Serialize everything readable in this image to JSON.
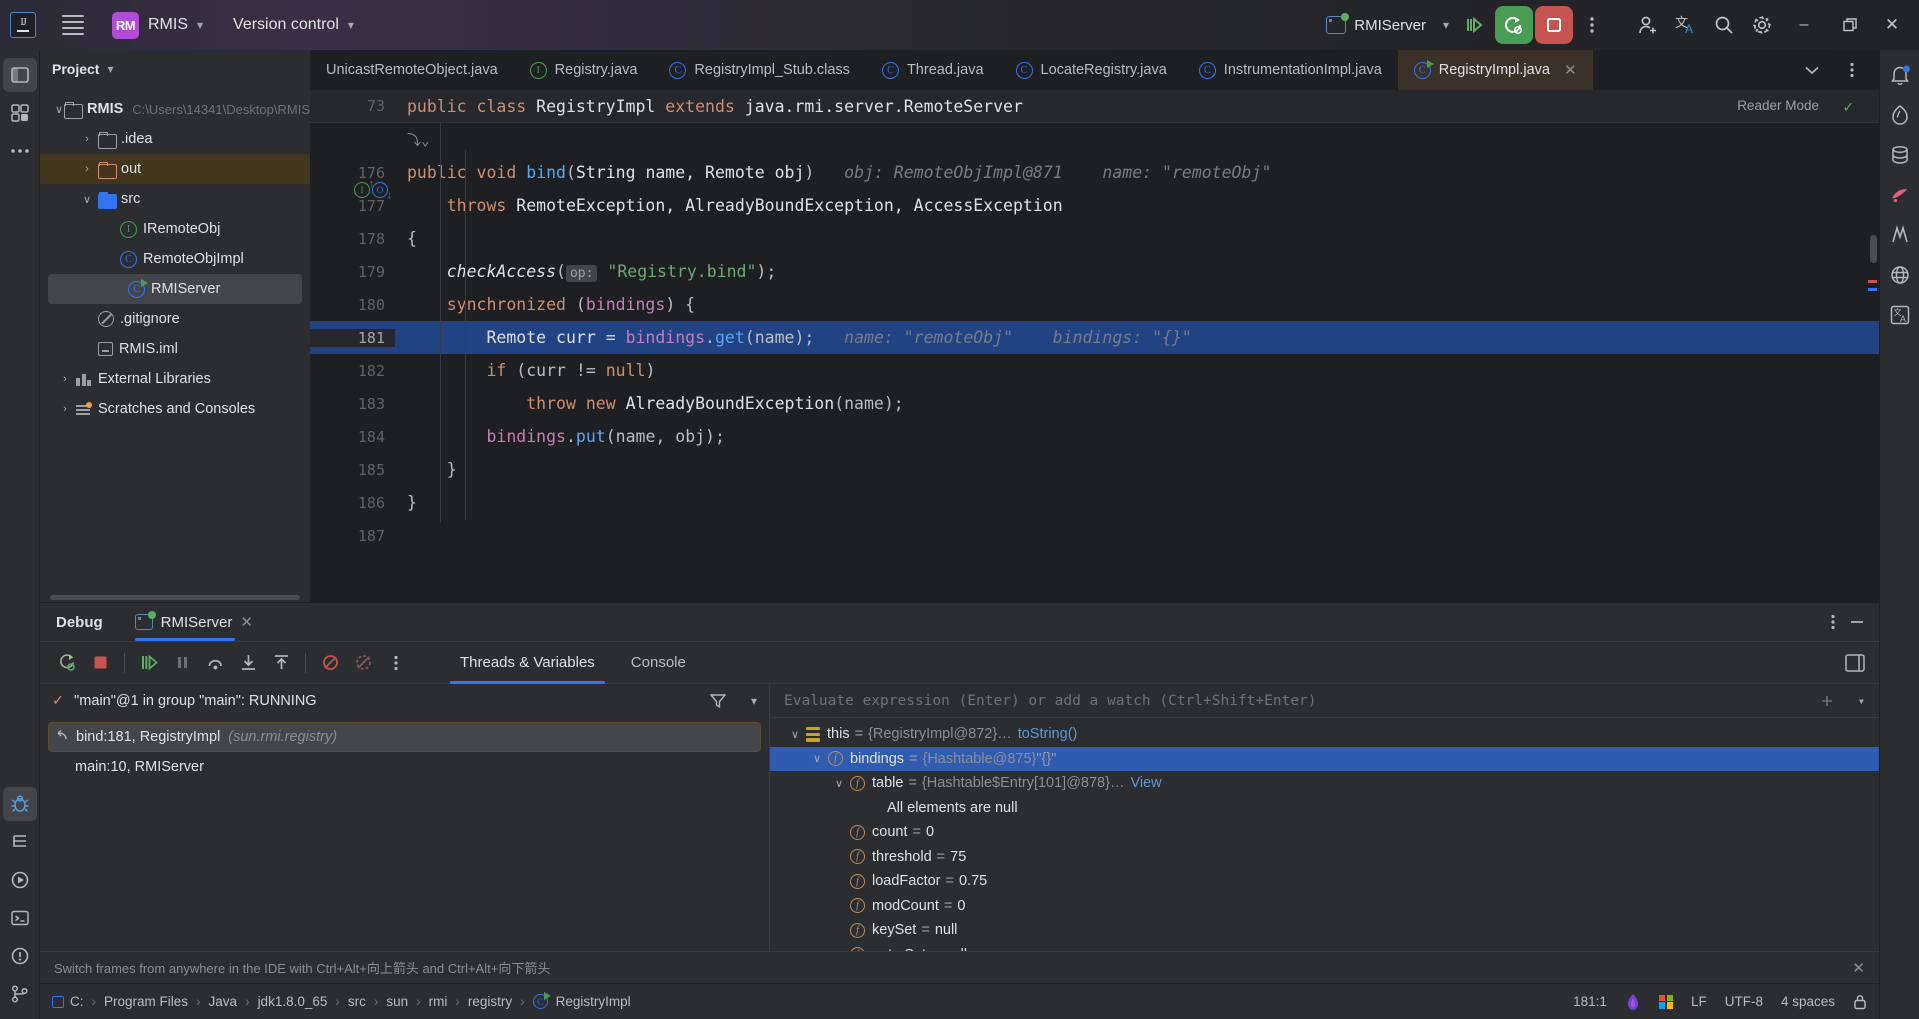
{
  "titlebar": {
    "menu_icon": "hamburger-icon",
    "project_badge": "RM",
    "project_name": "RMIS",
    "version_control": "Version control",
    "run_config": "RMIServer",
    "icons": [
      "debug-icon",
      "run-with-coverage-icon",
      "stop-icon",
      "more-actions-icon",
      "add-user-icon",
      "translate-icon",
      "search-icon",
      "settings-icon"
    ],
    "window": {
      "minimize": "–",
      "maximize": "❐",
      "close": "✕"
    }
  },
  "project_panel": {
    "title": "Project",
    "tree": [
      {
        "label": "RMIS",
        "path": "C:\\Users\\14341\\Desktop\\RMIS",
        "icon": "project-folder-icon",
        "arrow": "∨",
        "indent": 0,
        "bold": true,
        "state": "none"
      },
      {
        "label": ".idea",
        "path": "",
        "icon": "folder-icon",
        "arrow": "›",
        "indent": 1,
        "bold": false,
        "state": "none"
      },
      {
        "label": "out",
        "path": "",
        "icon": "folder-orange-icon",
        "arrow": "›",
        "indent": 1,
        "bold": false,
        "state": "highlight"
      },
      {
        "label": "src",
        "path": "",
        "icon": "folder-blue-icon",
        "arrow": "∨",
        "indent": 1,
        "bold": false,
        "state": "none"
      },
      {
        "label": "IRemoteObj",
        "path": "",
        "icon": "interface-icon",
        "arrow": "",
        "indent": 2,
        "bold": false,
        "state": "none"
      },
      {
        "label": "RemoteObjImpl",
        "path": "",
        "icon": "class-icon",
        "arrow": "",
        "indent": 2,
        "bold": false,
        "state": "none"
      },
      {
        "label": "RMIServer",
        "path": "",
        "icon": "runnable-class-icon",
        "arrow": "",
        "indent": 2,
        "bold": false,
        "state": "selected"
      },
      {
        "label": ".gitignore",
        "path": "",
        "icon": "gitignore-icon",
        "arrow": "",
        "indent": 1,
        "bold": false,
        "state": "none"
      },
      {
        "label": "RMIS.iml",
        "path": "",
        "icon": "iml-icon",
        "arrow": "",
        "indent": 1,
        "bold": false,
        "state": "none"
      },
      {
        "label": "External Libraries",
        "path": "",
        "icon": "library-icon",
        "arrow": "›",
        "indent": 0,
        "bold": false,
        "state": "none"
      },
      {
        "label": "Scratches and Consoles",
        "path": "",
        "icon": "scratches-icon",
        "arrow": "›",
        "indent": 0,
        "bold": false,
        "state": "none"
      }
    ]
  },
  "editor": {
    "tabs": [
      {
        "label": "UnicastRemoteObject.java",
        "icon": "",
        "active": false,
        "closable": false
      },
      {
        "label": "Registry.java",
        "icon": "interface-icon",
        "active": false,
        "closable": false
      },
      {
        "label": "RegistryImpl_Stub.class",
        "icon": "class-decompiled-icon",
        "active": false,
        "closable": false
      },
      {
        "label": "Thread.java",
        "icon": "class-icon",
        "active": false,
        "closable": false
      },
      {
        "label": "LocateRegistry.java",
        "icon": "class-decompiled-icon",
        "active": false,
        "closable": false
      },
      {
        "label": "InstrumentationImpl.java",
        "icon": "class-icon",
        "active": false,
        "closable": false
      },
      {
        "label": "RegistryImpl.java",
        "icon": "runnable-class-icon",
        "active": true,
        "closable": true
      }
    ],
    "tab_actions": [
      "chevron-down-icon",
      "more-vertical-icon"
    ],
    "reader_mode": "Reader Mode",
    "inspection_status": "✓",
    "sticky_line": {
      "number": "73",
      "code": "public class RegistryImpl extends java.rmi.server.RemoteServer"
    },
    "lines": [
      {
        "number": "",
        "tokens": [
          {
            "t": "fold",
            "v": "⤵⌄"
          }
        ]
      },
      {
        "number": "176",
        "gutter_icons": [
          "implemented-method-icon",
          "overridden-method-icon"
        ],
        "tokens": [
          {
            "t": "kw",
            "v": "public "
          },
          {
            "t": "kw",
            "v": "void "
          },
          {
            "t": "meth",
            "v": "bind"
          },
          {
            "t": "plain",
            "v": "("
          },
          {
            "t": "typ",
            "v": "String name, Remote obj"
          },
          {
            "t": "plain",
            "v": ")"
          },
          {
            "t": "hint",
            "v": "   obj: RemoteObjImpl@871    name: \"remoteObj\""
          }
        ]
      },
      {
        "number": "177",
        "tokens": [
          {
            "t": "plain",
            "v": "    "
          },
          {
            "t": "kw",
            "v": "throws "
          },
          {
            "t": "typ",
            "v": "RemoteException, AlreadyBoundException, AccessException"
          }
        ]
      },
      {
        "number": "178",
        "tokens": [
          {
            "t": "plain",
            "v": "{"
          }
        ]
      },
      {
        "number": "179",
        "tokens": [
          {
            "t": "plain",
            "v": "    "
          },
          {
            "t": "ital",
            "v": "checkAccess"
          },
          {
            "t": "plain",
            "v": "("
          },
          {
            "t": "badge",
            "v": "op:"
          },
          {
            "t": "str",
            "v": " \"Registry.bind\""
          },
          {
            "t": "plain",
            "v": ");"
          }
        ]
      },
      {
        "number": "180",
        "tokens": [
          {
            "t": "plain",
            "v": "    "
          },
          {
            "t": "kw",
            "v": "synchronized "
          },
          {
            "t": "plain",
            "v": "("
          },
          {
            "t": "fld",
            "v": "bindings"
          },
          {
            "t": "plain",
            "v": ") {"
          }
        ]
      },
      {
        "number": "181",
        "highlight": true,
        "tokens": [
          {
            "t": "plain",
            "v": "        "
          },
          {
            "t": "typ",
            "v": "Remote curr = "
          },
          {
            "t": "fld",
            "v": "bindings"
          },
          {
            "t": "plain",
            "v": "."
          },
          {
            "t": "meth",
            "v": "get"
          },
          {
            "t": "plain",
            "v": "(name);"
          },
          {
            "t": "hint",
            "v": "   name: \"remoteObj\"    bindings: \"{}\""
          }
        ]
      },
      {
        "number": "182",
        "tokens": [
          {
            "t": "plain",
            "v": "        "
          },
          {
            "t": "kw",
            "v": "if "
          },
          {
            "t": "plain",
            "v": "(curr != "
          },
          {
            "t": "kw",
            "v": "null"
          },
          {
            "t": "plain",
            "v": ")"
          }
        ]
      },
      {
        "number": "183",
        "tokens": [
          {
            "t": "plain",
            "v": "            "
          },
          {
            "t": "kw",
            "v": "throw new "
          },
          {
            "t": "typ",
            "v": "AlreadyBoundException"
          },
          {
            "t": "plain",
            "v": "(name);"
          }
        ]
      },
      {
        "number": "184",
        "tokens": [
          {
            "t": "plain",
            "v": "        "
          },
          {
            "t": "fld",
            "v": "bindings"
          },
          {
            "t": "plain",
            "v": "."
          },
          {
            "t": "meth",
            "v": "put"
          },
          {
            "t": "plain",
            "v": "(name, obj);"
          }
        ]
      },
      {
        "number": "185",
        "tokens": [
          {
            "t": "plain",
            "v": "    }"
          }
        ]
      },
      {
        "number": "186",
        "tokens": [
          {
            "t": "plain",
            "v": "}"
          }
        ]
      },
      {
        "number": "187",
        "tokens": [
          {
            "t": "plain",
            "v": ""
          }
        ]
      }
    ]
  },
  "debug": {
    "panel_title": "Debug",
    "session_tab": "RMIServer",
    "session_tab_close": "✕",
    "header_actions": [
      "more-vertical-icon",
      "minimize-icon"
    ],
    "toolbar": [
      "rerun-icon",
      "stop-icon",
      "resume-icon",
      "pause-icon",
      "step-over-icon",
      "step-into-icon",
      "step-out-icon",
      "mute-breakpoints-icon",
      "view-breakpoints-icon",
      "more-vertical-icon"
    ],
    "view_tabs": [
      {
        "label": "Threads & Variables",
        "active": true
      },
      {
        "label": "Console",
        "active": false
      }
    ],
    "layout_icon": "layout-settings-icon",
    "thread": {
      "status_icon": "✓",
      "label": "\"main\"@1 in group \"main\": RUNNING",
      "filter_icon": "filter-icon",
      "chevron": "∨"
    },
    "frames": [
      {
        "label": "bind:181, RegistryImpl",
        "package": "(sun.rmi.registry)",
        "icon": "frame-return-icon",
        "selected": true
      },
      {
        "label": "main:10, RMIServer",
        "package": "",
        "icon": "",
        "selected": false
      }
    ],
    "evaluate_placeholder": "Evaluate expression (Enter) or add a watch (Ctrl+Shift+Enter)",
    "evaluate_actions": [
      "add-watch-icon",
      "chevron-down-icon"
    ],
    "variables": [
      {
        "indent": 0,
        "arrow": "∨",
        "icon": "this-icon",
        "name": "this",
        "eq": "=",
        "value": "{RegistryImpl@872}",
        "ellipsis": "…",
        "link": "toString()",
        "selected": false
      },
      {
        "indent": 1,
        "arrow": "∨",
        "icon": "field-icon",
        "name": "bindings",
        "eq": "=",
        "value": "{Hashtable@875}",
        "suffix": "\"{}\"",
        "selected": true
      },
      {
        "indent": 2,
        "arrow": "∨",
        "icon": "field-icon",
        "name": "table",
        "eq": "=",
        "value": "{Hashtable$Entry[101]@878}",
        "ellipsis": "…",
        "link": "View",
        "selected": false
      },
      {
        "indent": 3,
        "arrow": "",
        "icon": "",
        "name": "",
        "eq": "",
        "value": "All elements are null",
        "plain": true,
        "selected": false
      },
      {
        "indent": 2,
        "arrow": "",
        "icon": "field-icon",
        "name": "count",
        "eq": "=",
        "value": "0",
        "selected": false
      },
      {
        "indent": 2,
        "arrow": "",
        "icon": "field-icon",
        "name": "threshold",
        "eq": "=",
        "value": "75",
        "selected": false
      },
      {
        "indent": 2,
        "arrow": "",
        "icon": "field-icon",
        "name": "loadFactor",
        "eq": "=",
        "value": "0.75",
        "selected": false
      },
      {
        "indent": 2,
        "arrow": "",
        "icon": "field-icon",
        "name": "modCount",
        "eq": "=",
        "value": "0",
        "selected": false
      },
      {
        "indent": 2,
        "arrow": "",
        "icon": "field-icon",
        "name": "keySet",
        "eq": "=",
        "value": "null",
        "selected": false
      },
      {
        "indent": 2,
        "arrow": "",
        "icon": "field-icon",
        "name": "entrySet",
        "eq": "=",
        "value": "null",
        "selected": false
      }
    ],
    "hint": "Switch frames from anywhere in the IDE with Ctrl+Alt+向上箭头 and Ctrl+Alt+向下箭头",
    "hint_close": "✕"
  },
  "statusbar": {
    "breadcrumb": [
      "C:",
      "Program Files",
      "Java",
      "jdk1.8.0_65",
      "src",
      "sun",
      "rmi",
      "registry",
      "RegistryImpl"
    ],
    "separator": "›",
    "caret": "181:1",
    "line_separator": "LF",
    "encoding": "UTF-8",
    "indent": "4 spaces",
    "right_icons": [
      "idea-status-icon",
      "windows-icon",
      "lock-icon"
    ]
  },
  "left_rail": [
    "project-icon",
    "commit-icon",
    "more-tool-windows-icon",
    "debug-icon",
    "structure-icon",
    "run-icon",
    "terminal-icon",
    "problems-icon",
    "version-control-icon"
  ],
  "right_rail": [
    "notifications-icon",
    "ai-assistant-icon",
    "database-icon",
    "gradle-icon",
    "maven-icon",
    "web-icon",
    "translation-icon"
  ],
  "colors": {
    "accent": "#3574f0",
    "selection": "#214283",
    "run_green": "#499c54",
    "stop_red": "#c75450",
    "panel_bg": "#2b2d30",
    "editor_bg": "#1e1f22",
    "tab_active_bg": "#3c3129"
  }
}
